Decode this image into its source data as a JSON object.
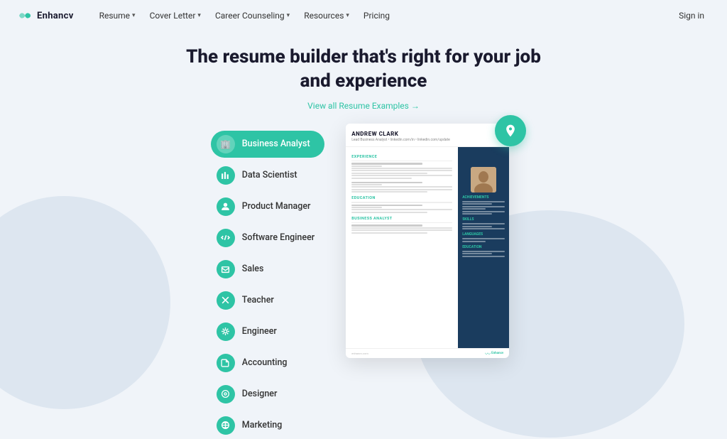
{
  "brand": {
    "name": "Enhancv",
    "logo_symbol": "◡◡"
  },
  "nav": {
    "items": [
      {
        "label": "Resume",
        "has_dropdown": true
      },
      {
        "label": "Cover Letter",
        "has_dropdown": true
      },
      {
        "label": "Career Counseling",
        "has_dropdown": true
      },
      {
        "label": "Resources",
        "has_dropdown": true
      },
      {
        "label": "Pricing",
        "has_dropdown": false
      }
    ],
    "signin_label": "Sign in"
  },
  "hero": {
    "title_line1": "The resume builder that's right for your job",
    "title_line2": "and experience",
    "view_examples_label": "View all Resume Examples →"
  },
  "job_categories": [
    {
      "label": "Business Analyst",
      "active": true,
      "icon": "🏢"
    },
    {
      "label": "Data Scientist",
      "active": false,
      "icon": "📊"
    },
    {
      "label": "Product Manager",
      "active": false,
      "icon": "👤"
    },
    {
      "label": "Software Engineer",
      "active": false,
      "icon": "💻"
    },
    {
      "label": "Sales",
      "active": false,
      "icon": "📋"
    },
    {
      "label": "Teacher",
      "active": false,
      "icon": "✕"
    },
    {
      "label": "Engineer",
      "active": false,
      "icon": "⚙"
    },
    {
      "label": "Accounting",
      "active": false,
      "icon": "📁"
    },
    {
      "label": "Designer",
      "active": false,
      "icon": "🎨"
    },
    {
      "label": "Marketing",
      "active": false,
      "icon": "📣"
    }
  ],
  "resume_preview": {
    "name": "ANDREW CLARK",
    "subtitle": "Lead Business Analyst  •  linkedin.com/in  •  linkedin.com/update",
    "footer_brand": "◡◡ Enhancv",
    "footer_text": "enhancv.com"
  }
}
